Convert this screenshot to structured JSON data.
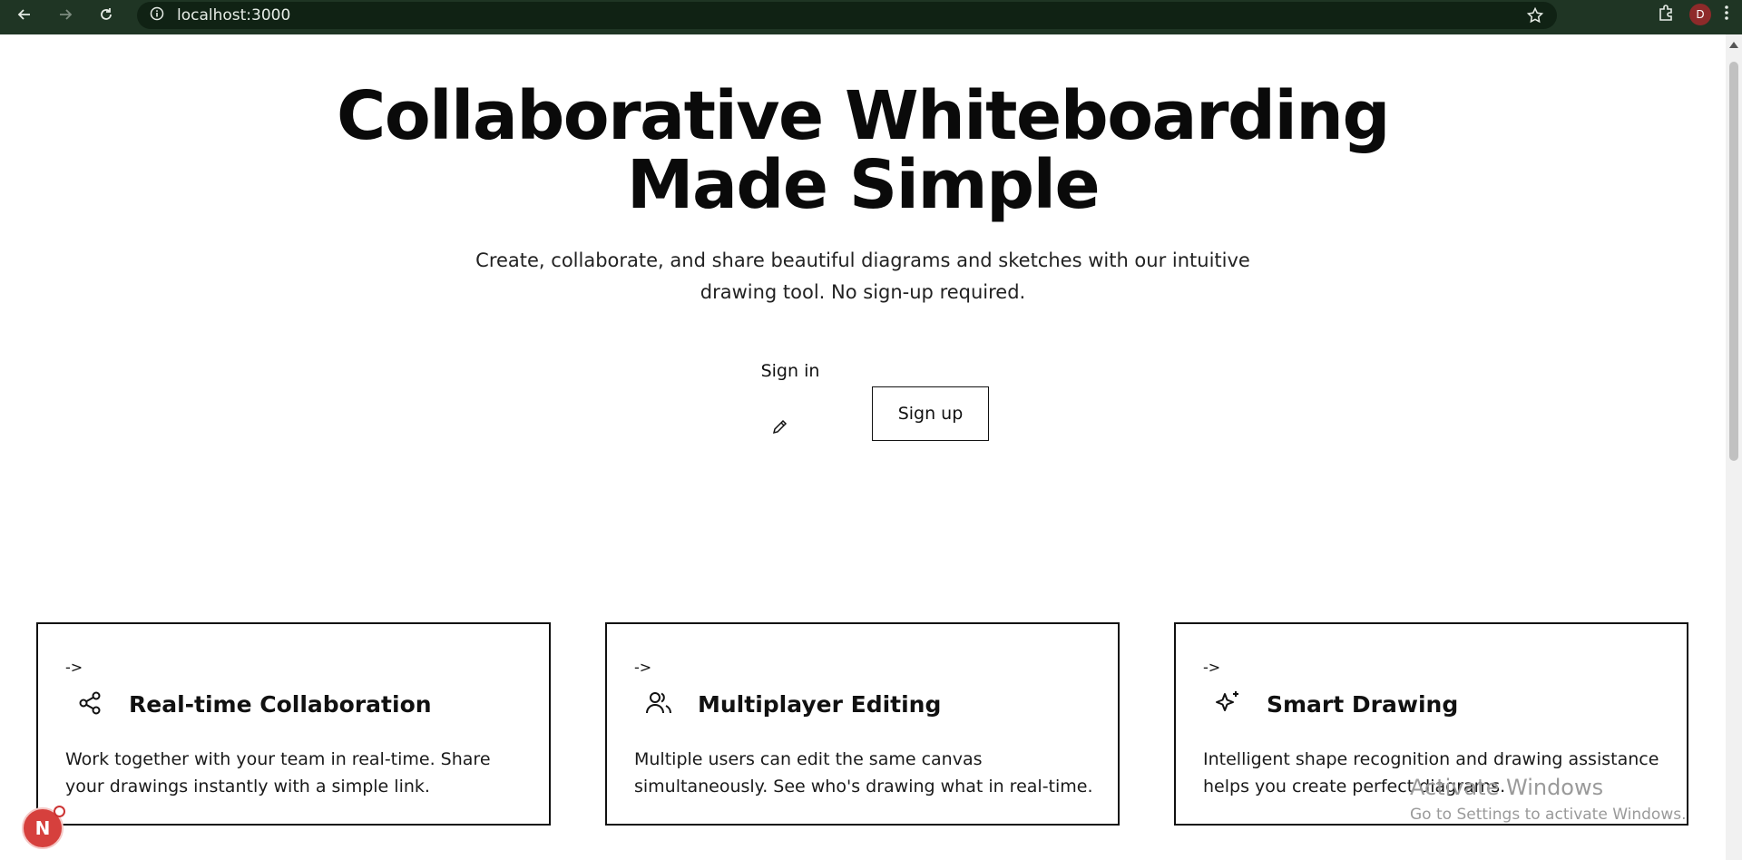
{
  "browser": {
    "url": "localhost:3000",
    "avatar_letter": "D",
    "icons": [
      "back-arrow-icon",
      "forward-arrow-icon",
      "reload-icon",
      "info-icon",
      "star-icon",
      "extensions-icon",
      "menu-dots-icon"
    ]
  },
  "hero": {
    "title_line1": "Collaborative Whiteboarding",
    "title_line2": "Made Simple",
    "subtitle": "Create, collaborate, and share beautiful diagrams and sketches with our intuitive drawing tool. No sign-up required."
  },
  "actions": {
    "signin_label": "Sign in",
    "signup_label": "Sign up"
  },
  "features": [
    {
      "arrow": "->",
      "icon": "share-icon",
      "title": "Real-time Collaboration",
      "description": "Work together with your team in real-time. Share your drawings instantly with a simple link."
    },
    {
      "arrow": "->",
      "icon": "users-icon",
      "title": "Multiplayer Editing",
      "description": "Multiple users can edit the same canvas simultaneously. See who's drawing what in real-time."
    },
    {
      "arrow": "->",
      "icon": "sparkles-icon",
      "title": "Smart Drawing",
      "description": "Intelligent shape recognition and drawing assistance helps you create perfect diagrams."
    }
  ],
  "watermark": {
    "title": "Activate Windows",
    "subtitle": "Go to Settings to activate Windows."
  },
  "dev_badge": {
    "letter": "N"
  },
  "colors": {
    "chrome_bg": "#1f3524",
    "omnibox_bg": "#102214",
    "badge_red": "#d6403d"
  }
}
